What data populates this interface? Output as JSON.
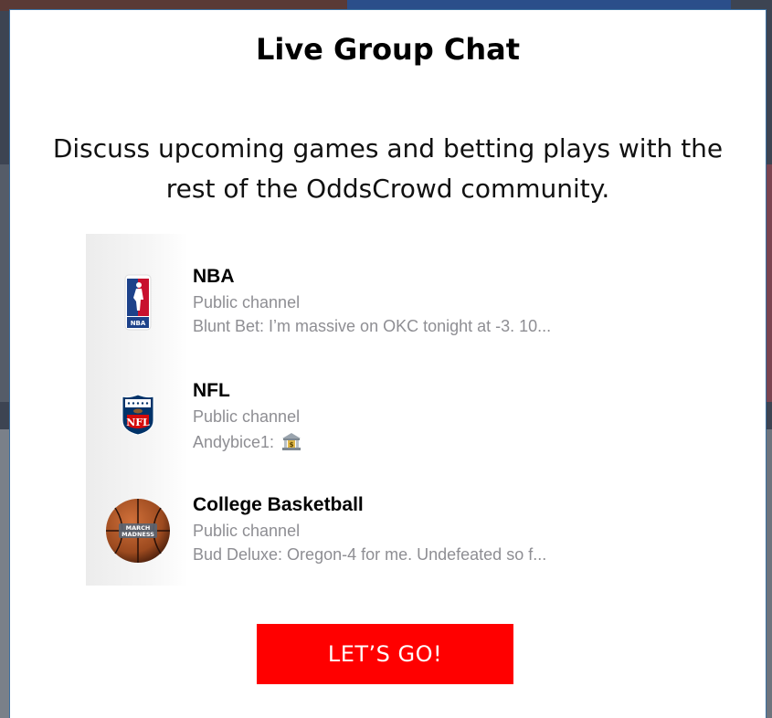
{
  "modal": {
    "title": "Live Group Chat",
    "subtitle_line1": "Discuss upcoming games and betting plays with the",
    "subtitle_line2": "rest of the OddsCrowd community."
  },
  "channels": [
    {
      "name": "NBA",
      "type": "Public channel",
      "last_message": "Blunt Bet: I’m massive on OKC tonight at -3. 10...",
      "icon": "nba-logo-icon"
    },
    {
      "name": "NFL",
      "type": "Public channel",
      "last_message": "Andybice1:",
      "icon": "nfl-logo-icon",
      "message_emoji": "bank-icon"
    },
    {
      "name": "College Basketball",
      "type": "Public channel",
      "last_message": "Bud Deluxe: Oregon-4 for me. Undefeated so f...",
      "icon": "march-madness-basketball-icon"
    }
  ],
  "cta": {
    "label": "LET’S GO!"
  },
  "colors": {
    "cta_background": "#ff0000",
    "secondary_text": "#8e8e93",
    "modal_border": "#3b6fa0"
  }
}
